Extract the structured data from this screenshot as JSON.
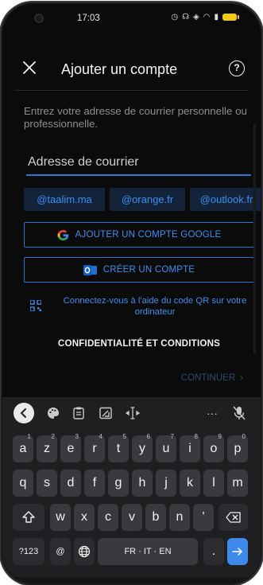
{
  "status_bar": {
    "time": "17:03",
    "icons": [
      "alarm-icon",
      "headset-icon",
      "vibrate-icon",
      "wifi-icon",
      "signal-icon",
      "battery-icon"
    ],
    "battery_color": "#f0c81a"
  },
  "header": {
    "title": "Ajouter un compte",
    "close_icon": "close-icon",
    "help_icon": "help-icon"
  },
  "form": {
    "instruction": "Entrez votre adresse de courrier personnelle ou professionnelle.",
    "email_value": "",
    "email_placeholder": "Adresse de courrier"
  },
  "domain_chips": [
    "@taalim.ma",
    "@orange.fr",
    "@outlook.fr"
  ],
  "actions": {
    "google_label": "AJOUTER UN COMPTE GOOGLE",
    "create_label": "CRÉER UN COMPTE",
    "qr_label": "Connectez-vous à l'aide du code QR sur votre ordinateur",
    "privacy_label": "CONFIDENTIALITÉ ET CONDITIONS",
    "continue_label": "CONTINUER"
  },
  "keyboard": {
    "toolbar": [
      "chevron-left-icon",
      "palette-icon",
      "clipboard-icon",
      "image-icon",
      "cursor-icon",
      "more-icon",
      "mic-off-icon"
    ],
    "toolbar_more": "···",
    "row1": [
      {
        "k": "a",
        "s": "1"
      },
      {
        "k": "z",
        "s": "2"
      },
      {
        "k": "e",
        "s": "3"
      },
      {
        "k": "r",
        "s": "4"
      },
      {
        "k": "t",
        "s": "5"
      },
      {
        "k": "y",
        "s": "6"
      },
      {
        "k": "u",
        "s": "7"
      },
      {
        "k": "i",
        "s": "8"
      },
      {
        "k": "o",
        "s": "9"
      },
      {
        "k": "p",
        "s": "0"
      }
    ],
    "row2": [
      "q",
      "s",
      "d",
      "f",
      "g",
      "h",
      "j",
      "k",
      "l",
      "m"
    ],
    "row3": [
      "w",
      "x",
      "c",
      "v",
      "b",
      "n",
      "'"
    ],
    "symbols_label": "?123",
    "at_label": "@",
    "space_label": "FR · IT · EN",
    "period_label": ".",
    "accent_color": "#3f89ea"
  }
}
